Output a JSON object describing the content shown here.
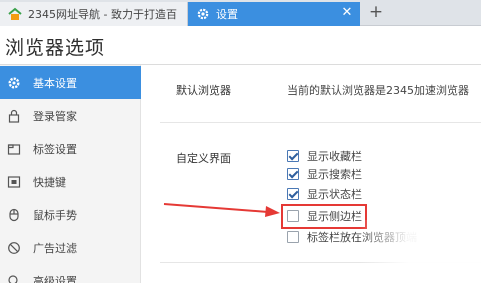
{
  "tabs": [
    {
      "title": "2345网址导航 - 致力于打造百",
      "active": false,
      "icon": "home-icon"
    },
    {
      "title": "设置",
      "active": true,
      "icon": "gear-icon",
      "close": "✕"
    }
  ],
  "new_tab_label": "+",
  "page": {
    "title": "浏览器选项"
  },
  "sidebar": {
    "items": [
      {
        "label": "基本设置",
        "icon": "gear-icon",
        "active": true
      },
      {
        "label": "登录管家",
        "icon": "lock-icon"
      },
      {
        "label": "标签设置",
        "icon": "tab-icon"
      },
      {
        "label": "快捷键",
        "icon": "keyboard-icon"
      },
      {
        "label": "鼠标手势",
        "icon": "mouse-icon"
      },
      {
        "label": "广告过滤",
        "icon": "block-icon"
      },
      {
        "label": "高级设置",
        "icon": "search-icon"
      }
    ]
  },
  "default_browser": {
    "label": "默认浏览器",
    "value": "当前的默认浏览器是2345加速浏览器"
  },
  "custom_ui": {
    "label": "自定义界面",
    "options": [
      {
        "label": "显示收藏栏",
        "checked": true
      },
      {
        "label": "显示搜索栏",
        "checked": true
      },
      {
        "label": "显示状态栏",
        "checked": true
      },
      {
        "label": "显示侧边栏",
        "checked": false
      },
      {
        "label": "标签栏放在浏览器顶端",
        "checked": false
      }
    ]
  },
  "colors": {
    "accent": "#3b8fe0",
    "annotation": "#e53935"
  }
}
